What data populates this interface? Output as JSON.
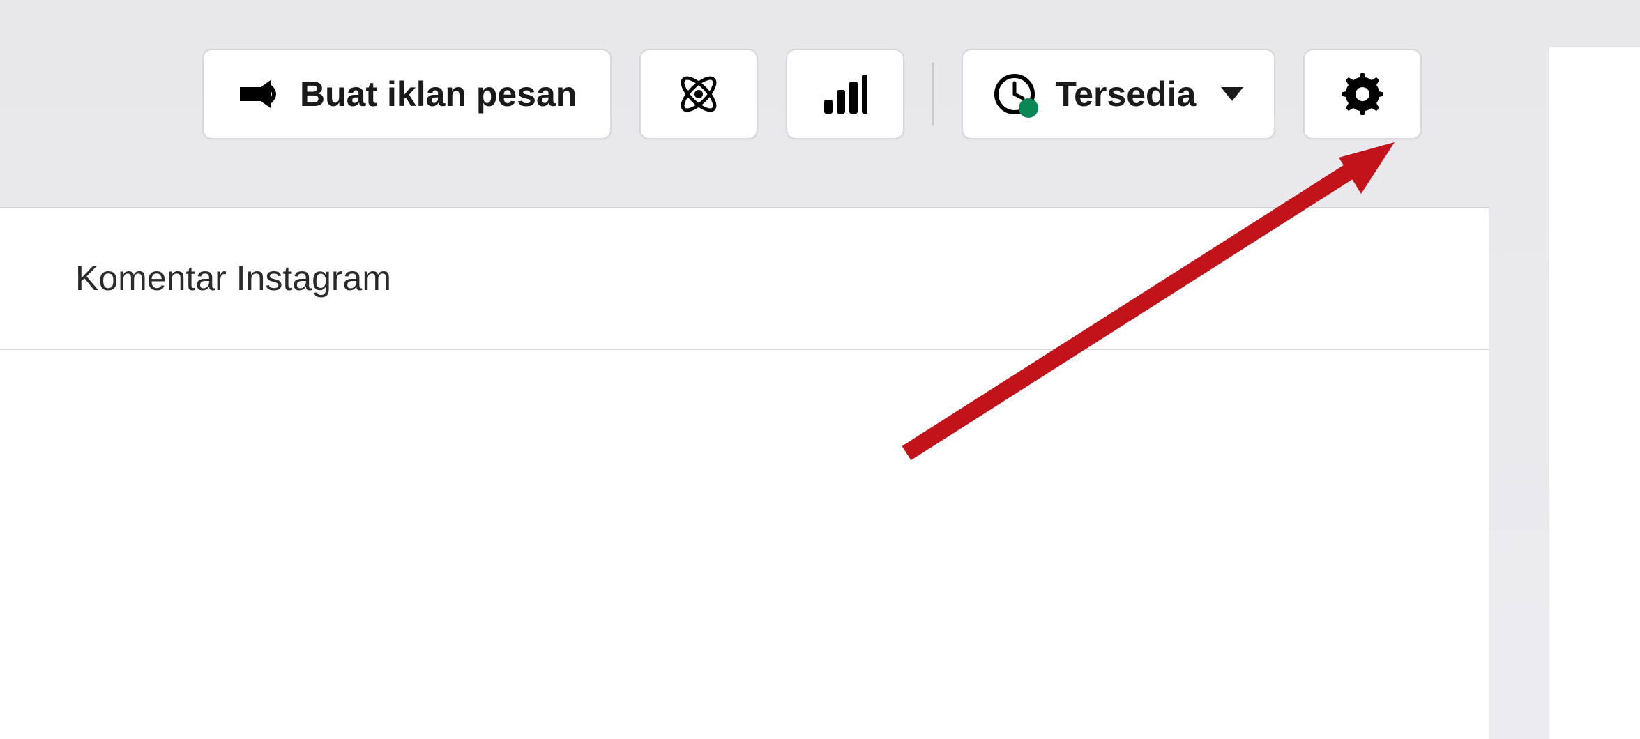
{
  "toolbar": {
    "create_ad_label": "Buat iklan pesan",
    "status_label": "Tersedia",
    "status_color": "#0a8754"
  },
  "content": {
    "header_title": "Komentar Instagram"
  },
  "annotation": {
    "arrow_color": "#c2131a"
  }
}
